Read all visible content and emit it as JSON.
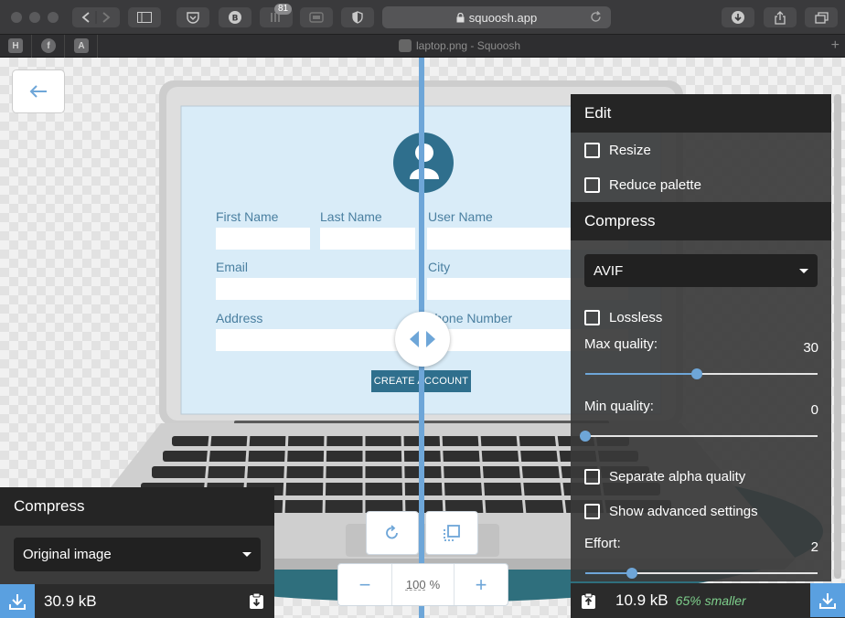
{
  "browser": {
    "url": "squoosh.app",
    "badge_count": "81",
    "tab_title": "laptop.png - Squoosh",
    "favorites": [
      "H",
      "f",
      "A"
    ]
  },
  "preview": {
    "form": {
      "first_name": "First Name",
      "last_name": "Last Name",
      "user_name": "User Name",
      "email": "Email",
      "city": "City",
      "address": "Address",
      "phone": "Phone Number",
      "create_button": "CREATE ACCOUNT"
    }
  },
  "left_panel": {
    "title": "Compress",
    "selected": "Original image",
    "size": "30.9 kB"
  },
  "zoom": {
    "value": "100",
    "unit": "%",
    "minus": "−",
    "plus": "+"
  },
  "right_panel": {
    "edit_title": "Edit",
    "resize": "Resize",
    "reduce_palette": "Reduce palette",
    "compress_title": "Compress",
    "codec": "AVIF",
    "lossless": "Lossless",
    "max_quality_label": "Max quality:",
    "max_quality": "30",
    "min_quality_label": "Min quality:",
    "min_quality": "0",
    "separate_alpha": "Separate alpha quality",
    "advanced": "Show advanced settings",
    "effort_label": "Effort:",
    "effort": "2",
    "size": "10.9 kB",
    "savings": "65% smaller"
  },
  "sliders": {
    "max_quality_fraction": 0.48,
    "min_quality_fraction": 0.0,
    "effort_fraction": 0.2
  },
  "colors": {
    "accent": "#6ea6d8",
    "savings_green": "#7ecf8c",
    "panel_dark": "#252525"
  }
}
